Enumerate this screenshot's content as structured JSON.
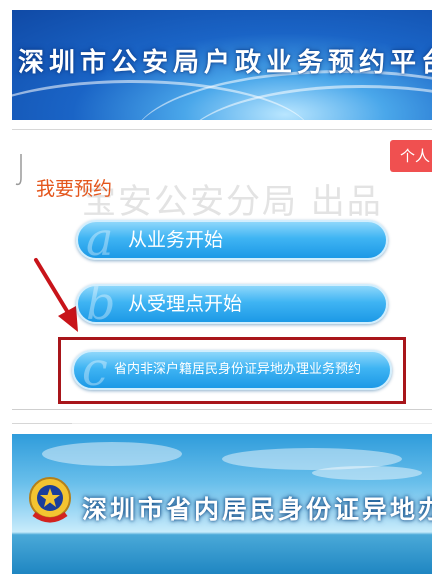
{
  "header": {
    "title": "深圳市公安局户政业务预约平台"
  },
  "panel": {
    "watermark": "宝安公安分局 出品",
    "tab_label": "个人",
    "section_title": "我要预约",
    "buttons": [
      {
        "letter": "a",
        "label": "从业务开始"
      },
      {
        "letter": "b",
        "label": "从受理点开始"
      },
      {
        "letter": "c",
        "label": "省内非深户籍居民身份证异地办理业务预约"
      }
    ]
  },
  "footer_banner": {
    "title": "深圳市省内居民身份证异地办"
  },
  "colors": {
    "accent_red": "#a8151a",
    "title_orange": "#e4561c",
    "button_blue": "#2aa6ee",
    "tab_red": "#f05050"
  }
}
